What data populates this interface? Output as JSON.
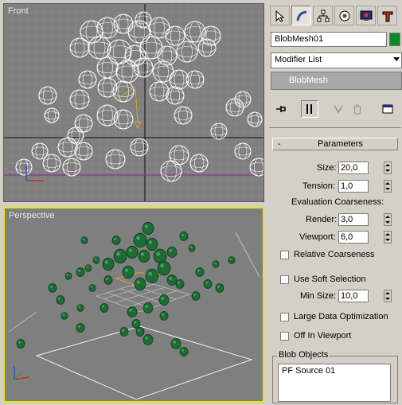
{
  "viewports": {
    "front": {
      "label": "Front"
    },
    "perspective": {
      "label": "Perspective"
    }
  },
  "panel": {
    "tabs": [
      "select-icon",
      "bend-icon",
      "hierarchy-icon",
      "motion-icon",
      "display-icon",
      "utilities-icon"
    ],
    "object_name": "BlobMesh01",
    "object_color": "#0a8a2a",
    "modifier_list": "Modifier List",
    "stack_item": "BlobMesh",
    "rollout_toggle": "-",
    "rollout_title": "Parameters",
    "params": {
      "size_label": "Size:",
      "size_value": "20,0",
      "tension_label": "Tension:",
      "tension_value": "1,0",
      "eval_label": "Evaluation Coarseness:",
      "render_label": "Render:",
      "render_value": "3,0",
      "viewport_label": "Viewport:",
      "viewport_value": "6,0",
      "relative_coarseness": "Relative Coarseness",
      "use_soft_selection": "Use Soft Selection",
      "min_size_label": "Min Size:",
      "min_size_value": "10,0",
      "large_data": "Large Data Optimization",
      "off_in_viewport": "Off In Viewport"
    },
    "blob_objects": {
      "title": "Blob Objects",
      "items": [
        "PF Source 01"
      ]
    }
  },
  "colors": {
    "wire": "#ffffff",
    "blob_green": "#1e6b35",
    "active_border": "#e8e800",
    "viewport_bg": "#7f7f7f"
  }
}
